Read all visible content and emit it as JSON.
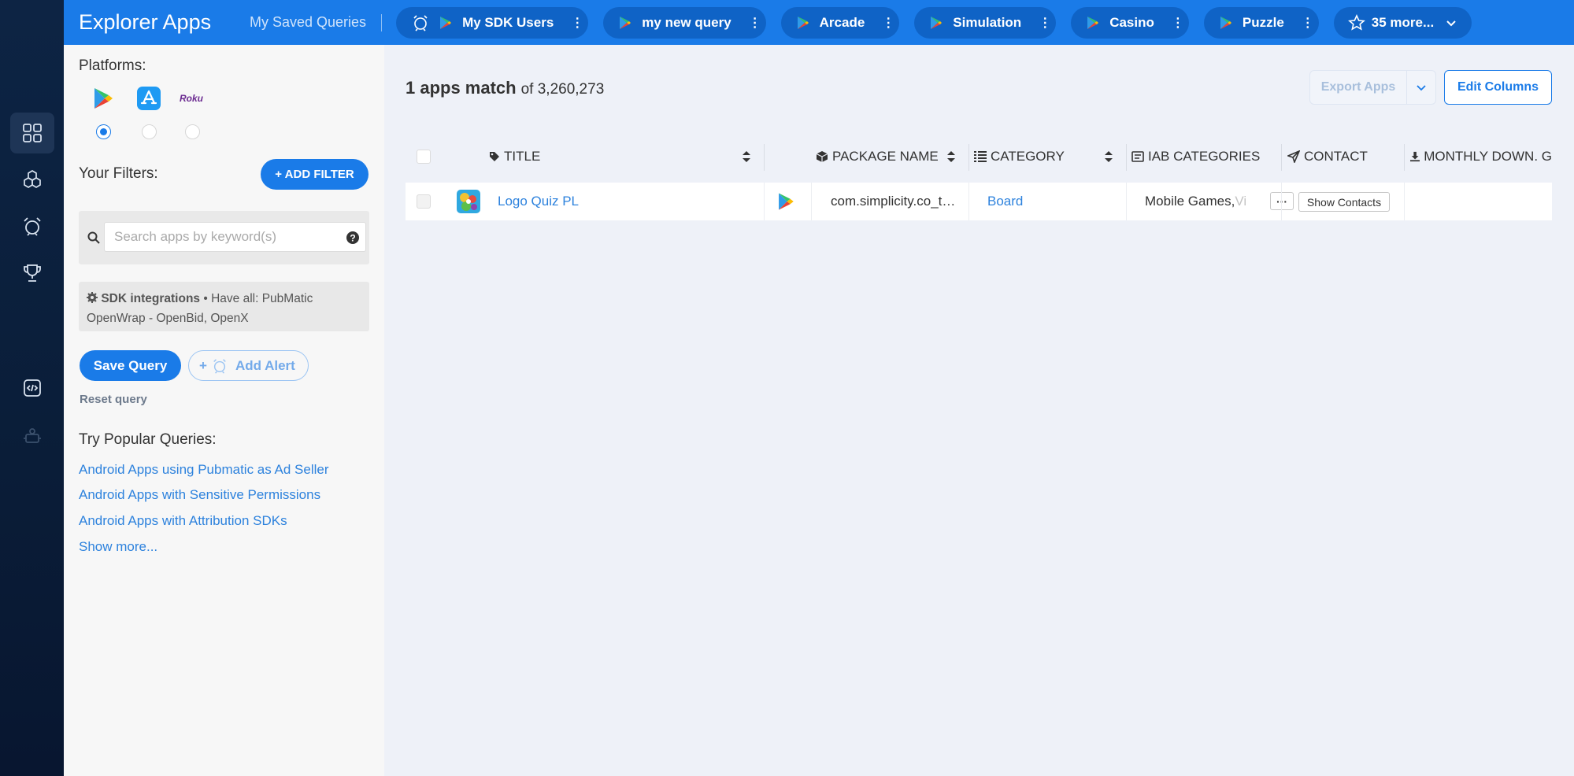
{
  "nav_rail": {
    "items": [
      "apps-grid-icon",
      "sdk-cubes-icon",
      "alarm-clock-icon",
      "trophy-icon",
      "code-window-icon",
      "robot-icon"
    ],
    "active": "apps-grid-icon"
  },
  "topbar": {
    "title": "Explorer Apps",
    "saved_queries_label": "My Saved Queries",
    "query_tabs": [
      {
        "label": "My SDK Users",
        "icons": [
          "alarm-clock-icon",
          "google-play-icon"
        ]
      },
      {
        "label": "my new query",
        "icons": [
          "google-play-icon"
        ]
      },
      {
        "label": "Arcade",
        "icons": [
          "google-play-icon"
        ]
      },
      {
        "label": "Simulation",
        "icons": [
          "google-play-icon"
        ]
      },
      {
        "label": "Casino",
        "icons": [
          "google-play-icon"
        ]
      },
      {
        "label": "Puzzle",
        "icons": [
          "google-play-icon"
        ]
      }
    ],
    "more_label": "35 more...",
    "tab_menu_glyph": "⋮"
  },
  "sidebar": {
    "platforms_label": "Platforms:",
    "platforms": [
      {
        "name": "google-play-icon",
        "selected": true
      },
      {
        "name": "app-store-icon",
        "selected": false
      },
      {
        "name": "roku-icon",
        "selected": false,
        "text": "Roku"
      }
    ],
    "filters_label": "Your Filters:",
    "add_filter_label": "+ ADD FILTER",
    "search_placeholder": "Search apps by keyword(s)",
    "search_value": "",
    "sdk_filter": {
      "title": "SDK integrations",
      "separator": "•",
      "description": "Have all: PubMatic OpenWrap - OpenBid, OpenX"
    },
    "save_query_label": "Save Query",
    "add_alert_label": "Add Alert",
    "add_alert_prefix": "+",
    "reset_label": "Reset query",
    "popular_label": "Try Popular Queries:",
    "popular_queries": [
      "Android Apps using Pubmatic as Ad Seller",
      "Android Apps with Sensitive Permissions",
      "Android Apps with Attribution SDKs"
    ],
    "show_more_label": "Show more..."
  },
  "main": {
    "match_count": "1 apps match",
    "total": "of 3,260,273",
    "export_label": "Export Apps",
    "edit_columns_label": "Edit Columns",
    "columns": [
      "TITLE",
      "PACKAGE NAME",
      "CATEGORY",
      "IAB CATEGORIES",
      "CONTACT",
      "MONTHLY DOWN. G"
    ],
    "rows": [
      {
        "title": "Logo Quiz PL",
        "platform": "google-play-icon",
        "package": "com.simplicity.co_t…",
        "category": "Board",
        "iab_visible": "Mobile Games, ",
        "iab_faded": "Vi",
        "iab_more": "···",
        "contact_button": "Show Contacts",
        "monthly_downloads": ""
      }
    ]
  },
  "colors": {
    "brand_blue": "#1a7be8",
    "tab_blue": "#0f63c6",
    "rail_navy": "#0d2444",
    "link_blue": "#2d82dd"
  }
}
